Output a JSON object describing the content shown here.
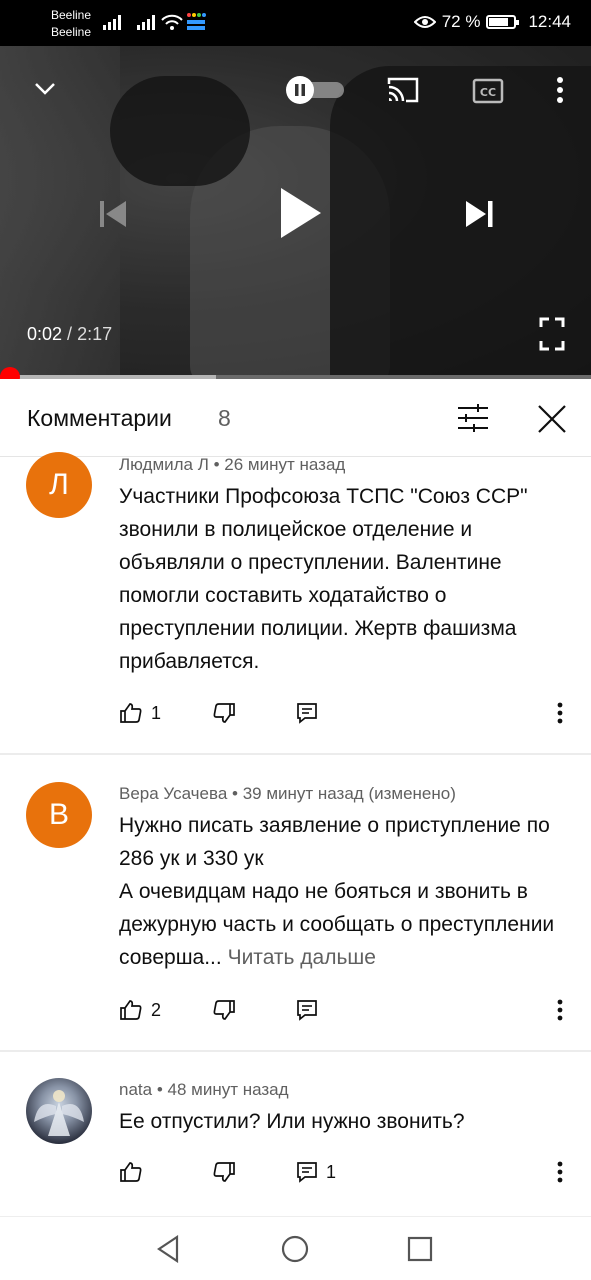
{
  "status_bar": {
    "carrier1": "Beeline",
    "carrier2": "Beeline",
    "battery": "72 %",
    "battery_level": 0.72,
    "time": "12:44"
  },
  "player": {
    "current_time": "0:02",
    "separator": " / ",
    "duration": "2:17",
    "played_fraction": 0.015,
    "buffered_fraction": 0.365,
    "icons": [
      "chevron-down-icon",
      "pause-toggle-icon",
      "cast-icon",
      "captions-icon",
      "more-vert-icon",
      "skip-previous-icon",
      "play-icon",
      "skip-next-icon",
      "fullscreen-icon"
    ]
  },
  "comments_header": {
    "title": "Комментарии",
    "count": "8"
  },
  "comments": [
    {
      "avatar_letter": "Л",
      "avatar_color": "#e8720c",
      "author": "Людмила Л",
      "time": "26 минут назад",
      "text": "Участники Профсоюза ТСПС \"Союз ССР\" звонили в полицейское отделение и объявляли о преступлении. Валентине помогли составить ходатайство о преступлении полиции. Жертв фашизма прибавляется.",
      "likes": "1",
      "replies": ""
    },
    {
      "avatar_letter": "В",
      "avatar_color": "#e8720c",
      "author": "Вера Усачева",
      "time": "39 минут назад (изменено)",
      "text_line1": "Нужно писать заявление о приступление по 286 ук и 330 ук",
      "text_line2": "А очевидцам надо не бояться и звонить в дежурную часть и сообщать о преступлении соверша...",
      "read_more": "Читать дальше",
      "likes": "2",
      "replies": ""
    },
    {
      "avatar_letter": "",
      "author": "nata",
      "time": "48 минут назад",
      "text": "Ее отпустили? Или нужно звонить?",
      "likes": "",
      "replies": "1"
    }
  ]
}
